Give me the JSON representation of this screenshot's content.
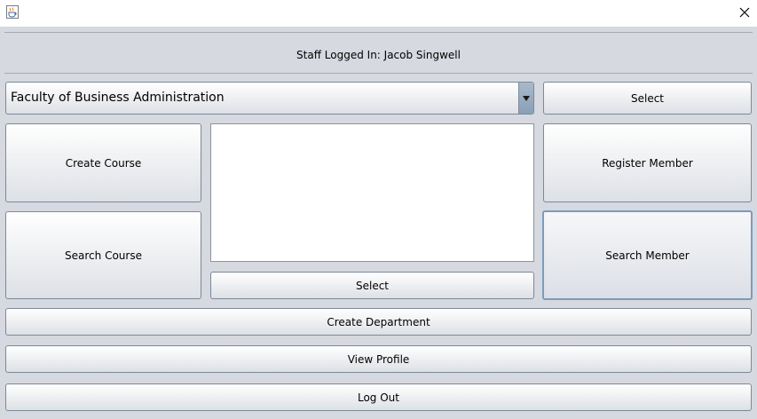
{
  "window": {
    "app_icon": "java-coffee-cup-icon",
    "close_icon": "close-icon"
  },
  "header": {
    "staff_label": "Staff Logged In: Jacob Singwell"
  },
  "faculty_select": {
    "selected": "Faculty of Business Administration",
    "arrow_icon": "chevron-down-icon"
  },
  "buttons": {
    "select_faculty": "Select",
    "create_course": "Create Course",
    "search_course": "Search Course",
    "select_list": "Select",
    "register_member": "Register Member",
    "search_member": "Search Member",
    "create_department": "Create Department",
    "view_profile": "View Profile",
    "log_out": "Log Out"
  },
  "list": {
    "items": []
  },
  "colors": {
    "panel_bg": "#d6d9df",
    "button_border": "#7a8a99",
    "focus_border": "#7b9bbe"
  }
}
